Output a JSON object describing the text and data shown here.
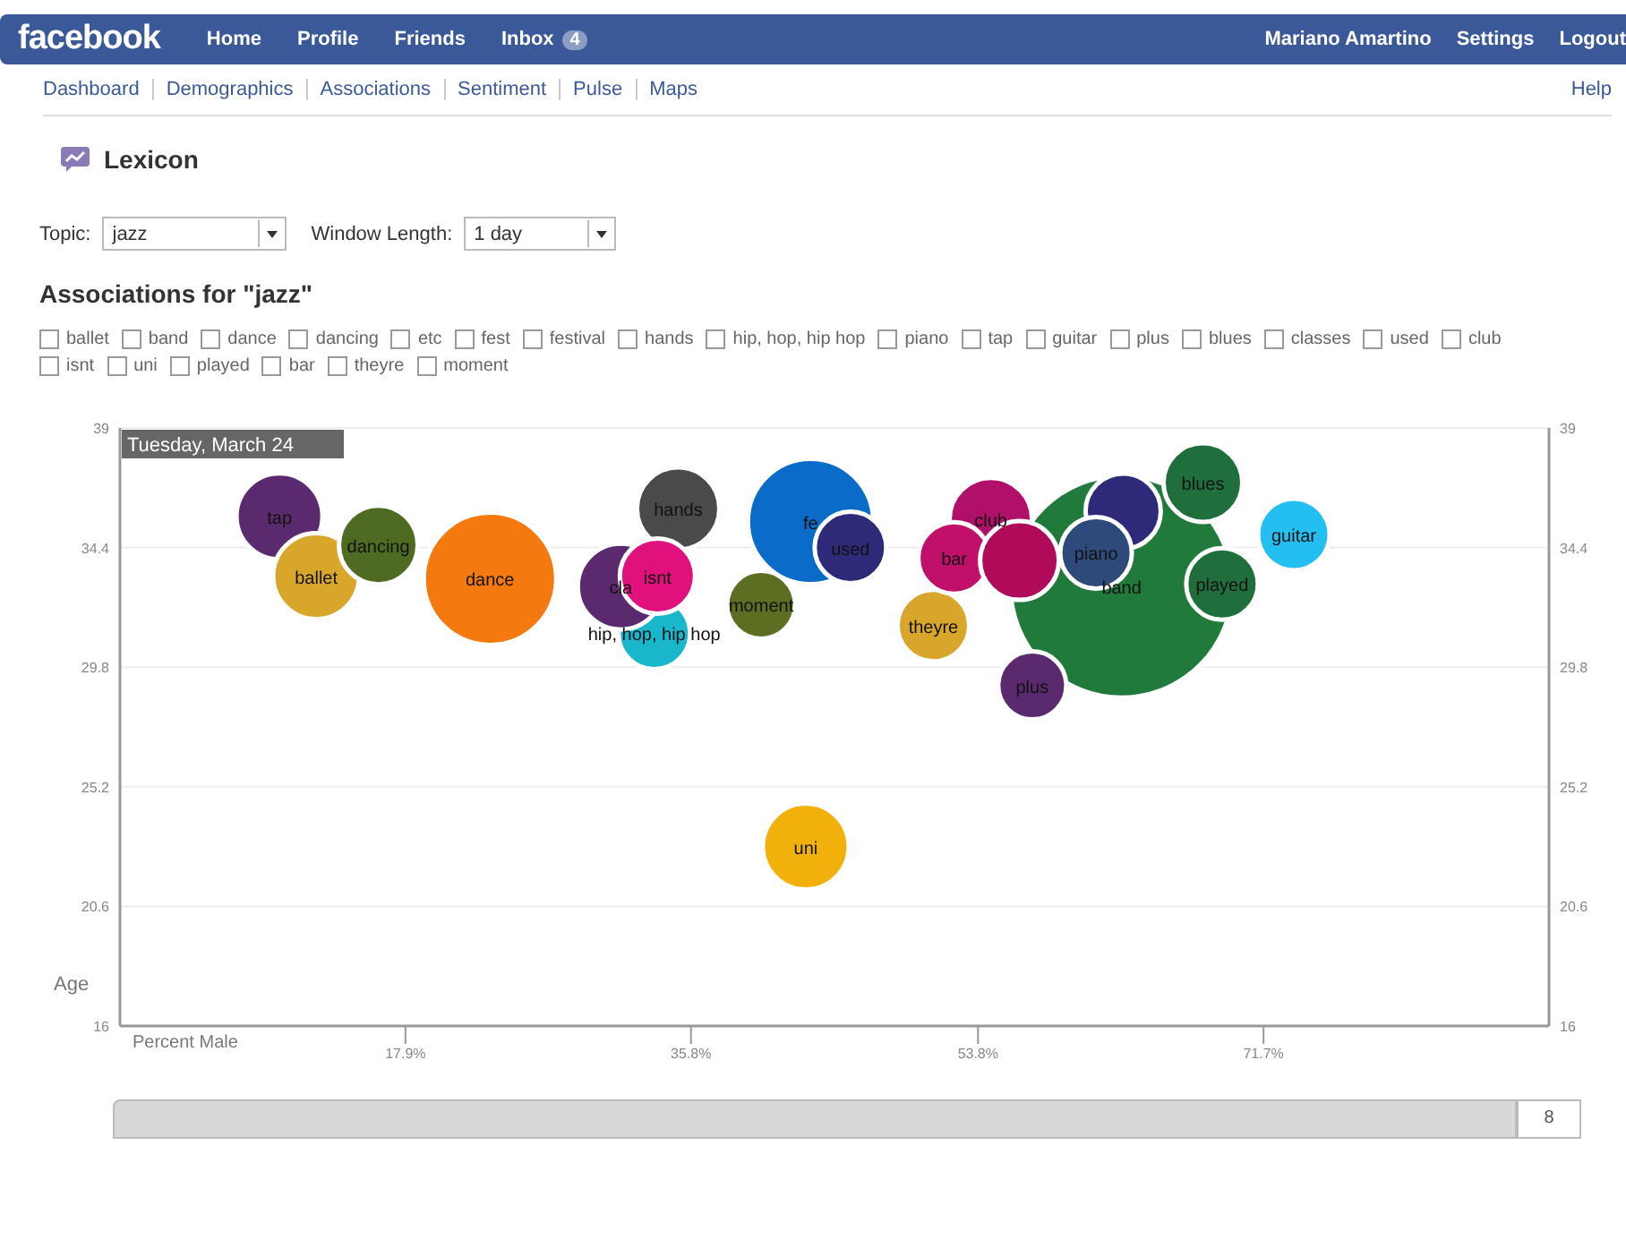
{
  "topbar": {
    "logo": "facebook",
    "nav": [
      {
        "label": "Home"
      },
      {
        "label": "Profile"
      },
      {
        "label": "Friends"
      },
      {
        "label": "Inbox",
        "badge": "4"
      }
    ],
    "user_links": [
      "Mariano Amartino",
      "Settings",
      "Logout"
    ]
  },
  "subnav": {
    "items": [
      "Dashboard",
      "Demographics",
      "Associations",
      "Sentiment",
      "Pulse",
      "Maps"
    ],
    "help": "Help"
  },
  "app_title": "Lexicon",
  "filters": [
    {
      "label": "Topic:",
      "value": "jazz"
    },
    {
      "label": "Window Length:",
      "value": "1 day"
    }
  ],
  "section_title": "Associations for \"jazz\"",
  "checkboxes": [
    {
      "label": "ballet",
      "checked": false
    },
    {
      "label": "band",
      "checked": false
    },
    {
      "label": "dance",
      "checked": false
    },
    {
      "label": "dancing",
      "checked": false
    },
    {
      "label": "etc",
      "checked": false
    },
    {
      "label": "fest",
      "checked": false
    },
    {
      "label": "festival",
      "checked": false
    },
    {
      "label": "hands",
      "checked": false
    },
    {
      "label": "hip, hop, hip hop",
      "checked": false
    },
    {
      "label": "piano",
      "checked": false
    },
    {
      "label": "tap",
      "checked": false
    },
    {
      "label": "guitar",
      "checked": false
    },
    {
      "label": "plus",
      "checked": false
    },
    {
      "label": "blues",
      "checked": false
    },
    {
      "label": "classes",
      "checked": false
    },
    {
      "label": "used",
      "checked": false
    },
    {
      "label": "club",
      "checked": false
    },
    {
      "label": "isnt",
      "checked": false
    },
    {
      "label": "uni",
      "checked": false
    },
    {
      "label": "played",
      "checked": false
    },
    {
      "label": "bar",
      "checked": false
    },
    {
      "label": "theyre",
      "checked": false
    },
    {
      "label": "moment",
      "checked": false
    }
  ],
  "chart": {
    "tooltip": "Tuesday, March 24",
    "timeline_value": "8",
    "right_axis_labels": [
      "39",
      "34.4",
      "29.8",
      "25.2",
      "20.6",
      "16"
    ],
    "chart_data": {
      "type": "scatter",
      "xlabel": "Percent Male",
      "ylabel": "Age",
      "xlim": [
        0,
        89.6
      ],
      "ylim": [
        16,
        39
      ],
      "xticks": [
        {
          "value": 17.9,
          "label": "17.9%"
        },
        {
          "value": 35.8,
          "label": "35.8%"
        },
        {
          "value": 53.8,
          "label": "53.8%"
        },
        {
          "value": 71.7,
          "label": "71.7%"
        }
      ],
      "yticks": [
        {
          "value": 16,
          "label": "16"
        },
        {
          "value": 20.6,
          "label": "20.6"
        },
        {
          "value": 25.2,
          "label": "25.2"
        },
        {
          "value": 29.8,
          "label": "29.8"
        },
        {
          "value": 34.4,
          "label": "34.4"
        },
        {
          "value": 39,
          "label": "39"
        }
      ],
      "grid": true,
      "series": [
        {
          "name": "band",
          "color": "#1f7a3c",
          "x": [
            62.8
          ],
          "values": [
            32.9
          ]
        },
        {
          "name": "tap",
          "color": "#5b2a6e",
          "x": [
            10.0
          ],
          "values": [
            35.6
          ]
        },
        {
          "name": "ballet",
          "color": "#d8a62b",
          "x": [
            12.3
          ],
          "values": [
            33.3
          ]
        },
        {
          "name": "dancing",
          "color": "#4f6b22",
          "x": [
            16.2
          ],
          "values": [
            34.5
          ]
        },
        {
          "name": "dance",
          "color": "#f47a10",
          "x": [
            23.2
          ],
          "values": [
            33.2
          ]
        },
        {
          "name": "hands",
          "color": "#4a4a4a",
          "x": [
            35.0
          ],
          "values": [
            35.9
          ]
        },
        {
          "name": "hip, hop, hip hop",
          "color": "#1ab6cc",
          "x": [
            33.5
          ],
          "values": [
            31.1
          ]
        },
        {
          "name": "cla",
          "color": "#5b2a6e",
          "x": [
            31.4
          ],
          "values": [
            32.9
          ]
        },
        {
          "name": "isnt",
          "color": "#e0107c",
          "x": [
            33.7
          ],
          "values": [
            33.3
          ]
        },
        {
          "name": "moment",
          "color": "#5b6e22",
          "x": [
            40.2
          ],
          "values": [
            32.2
          ]
        },
        {
          "name": "fe",
          "color": "#0a6bc8",
          "x": [
            43.3
          ],
          "values": [
            35.4
          ]
        },
        {
          "name": "used",
          "color": "#2e2a7a",
          "x": [
            45.8
          ],
          "values": [
            34.4
          ]
        },
        {
          "name": "theyre",
          "color": "#d8a62b",
          "x": [
            51.0
          ],
          "values": [
            31.4
          ]
        },
        {
          "name": "club",
          "color": "#b0106a",
          "x": [
            54.6
          ],
          "values": [
            35.5
          ]
        },
        {
          "name": "bar",
          "color": "#c0106a",
          "x": [
            52.3
          ],
          "values": [
            34.0
          ]
        },
        {
          "color": "#b00a5a",
          "x": [
            56.4
          ],
          "values": [
            33.9
          ]
        },
        {
          "color": "#2e2a7a",
          "x": [
            62.9
          ],
          "values": [
            35.8
          ]
        },
        {
          "name": "piano",
          "color": "#2e4a7a",
          "x": [
            61.2
          ],
          "values": [
            34.2
          ]
        },
        {
          "name": "blues",
          "color": "#1f6e3c",
          "x": [
            67.9
          ],
          "values": [
            36.9
          ]
        },
        {
          "name": "played",
          "color": "#1f6e3c",
          "x": [
            69.1
          ],
          "values": [
            33.0
          ]
        },
        {
          "name": "guitar",
          "color": "#22bff0",
          "x": [
            73.6
          ],
          "values": [
            34.9
          ]
        },
        {
          "name": "plus",
          "color": "#5b2a6e",
          "x": [
            57.2
          ],
          "values": [
            29.1
          ]
        },
        {
          "name": "uni",
          "color": "#f2b10a",
          "x": [
            43.0
          ],
          "values": [
            22.9
          ]
        }
      ]
    }
  }
}
